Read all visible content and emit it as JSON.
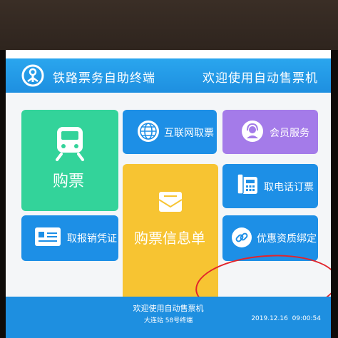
{
  "header": {
    "title": "铁路票务自助终端",
    "welcome": "欢迎使用自动售票机"
  },
  "tiles": {
    "buy_ticket": "购票",
    "internet_pickup": "互联网取票",
    "member_service": "会员服务",
    "ticket_info": "购票信息单",
    "phone_order_pickup": "取电话订票",
    "reimbursement_voucher": "取报销凭证",
    "discount_binding": "优惠资质绑定"
  },
  "footer": {
    "welcome": "欢迎使用自动售票机",
    "station": "大连站 58号终端",
    "date": "2019.12.16",
    "time": "09:00:54"
  },
  "colors": {
    "header_blue": "#1e8fe0",
    "tile_green": "#33d39a",
    "tile_blue": "#1d8fe6",
    "tile_purple": "#a47be9",
    "tile_yellow": "#f7c432",
    "annotation_red": "#e2242b"
  },
  "icons": {
    "logo": "railway-logo-icon",
    "buy_ticket": "train-icon",
    "internet_pickup": "globe-icon",
    "member_service": "customer-service-icon",
    "ticket_info": "envelope-icon",
    "phone_order_pickup": "telephone-icon",
    "reimbursement_voucher": "voucher-card-icon",
    "discount_binding": "link-icon"
  }
}
